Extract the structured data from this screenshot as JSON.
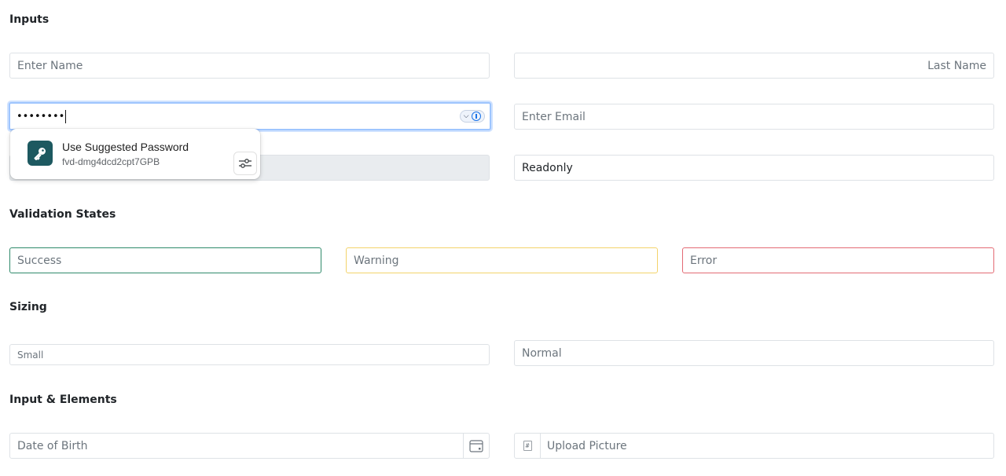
{
  "sections": {
    "inputs": "Inputs",
    "validation": "Validation States",
    "sizing": "Sizing",
    "input_elements": "Input & Elements"
  },
  "inputs": {
    "first_name_placeholder": "Enter Name",
    "last_name_placeholder": "Last Name",
    "password_value": "••••••••",
    "email_placeholder": "Enter Email",
    "readonly_value": "Readonly"
  },
  "validation": {
    "success_placeholder": "Success",
    "warning_placeholder": "Warning",
    "error_placeholder": "Error"
  },
  "sizing": {
    "small_placeholder": "Small",
    "normal_placeholder": "Normal"
  },
  "input_elements": {
    "dob_placeholder": "Date of Birth",
    "upload_placeholder": "Upload Picture"
  },
  "password_suggestion": {
    "title": "Use Suggested Password",
    "password": "fvd-dmg4dcd2cpt7GPB"
  },
  "colors": {
    "success": "#2f8a6a",
    "warning": "#f3d36b",
    "error": "#e36a74",
    "focus": "#9ec5fe",
    "key_tile": "#1d5960"
  },
  "icons": {
    "calendar": "calendar-icon",
    "file": "file-icon",
    "key": "key-icon",
    "sliders": "sliders-icon"
  }
}
